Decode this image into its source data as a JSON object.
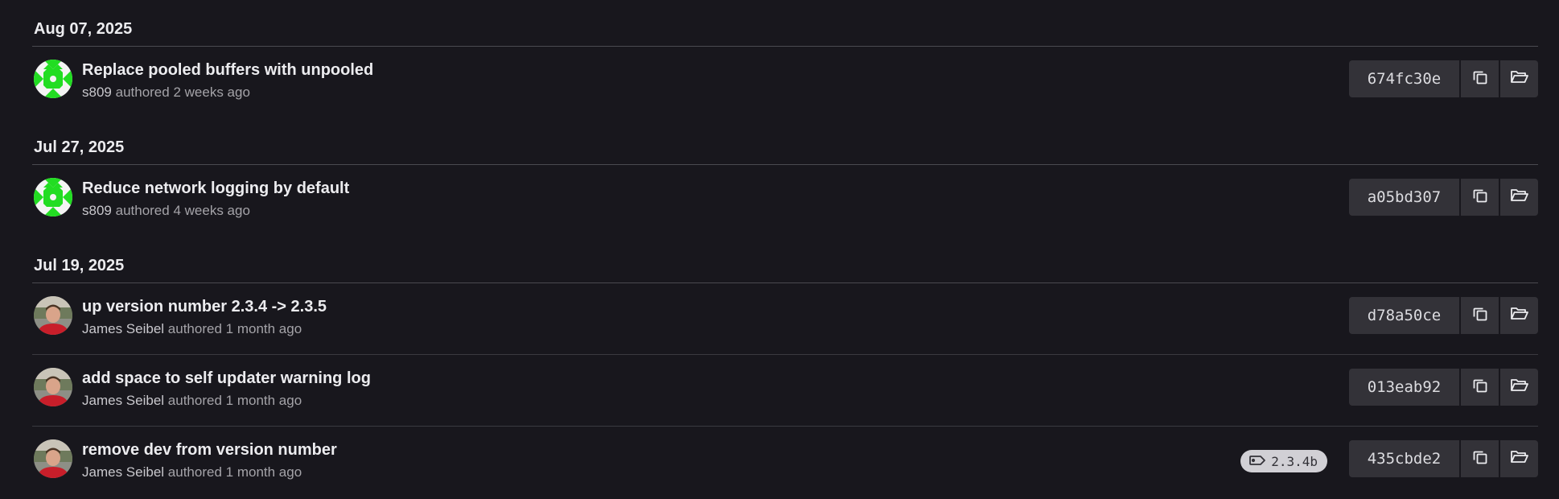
{
  "groups": [
    {
      "date": "Aug 07, 2025",
      "commits": [
        {
          "title": "Replace pooled buffers with unpooled",
          "author": "s809",
          "verb": "authored",
          "time": "2 weeks ago",
          "sha": "674fc30e",
          "avatar": "identicon-green"
        }
      ]
    },
    {
      "date": "Jul 27, 2025",
      "commits": [
        {
          "title": "Reduce network logging by default",
          "author": "s809",
          "verb": "authored",
          "time": "4 weeks ago",
          "sha": "a05bd307",
          "avatar": "identicon-green"
        }
      ]
    },
    {
      "date": "Jul 19, 2025",
      "commits": [
        {
          "title": "up version number 2.3.4 -> 2.3.5",
          "author": "James Seibel",
          "verb": "authored",
          "time": "1 month ago",
          "sha": "d78a50ce",
          "avatar": "photo"
        },
        {
          "title": "add space to self updater warning log",
          "author": "James Seibel",
          "verb": "authored",
          "time": "1 month ago",
          "sha": "013eab92",
          "avatar": "photo"
        },
        {
          "title": "remove dev from version number",
          "author": "James Seibel",
          "verb": "authored",
          "time": "1 month ago",
          "sha": "435cbde2",
          "avatar": "photo",
          "tag": "2.3.4b"
        }
      ]
    }
  ],
  "icons": {
    "copy": "copy-icon",
    "browse": "folder-open-icon",
    "tag": "tag-icon"
  },
  "colors": {
    "background": "#18171d",
    "button": "#333238",
    "identicon": "#22dd22",
    "tag_badge": "#d1d0d5"
  }
}
